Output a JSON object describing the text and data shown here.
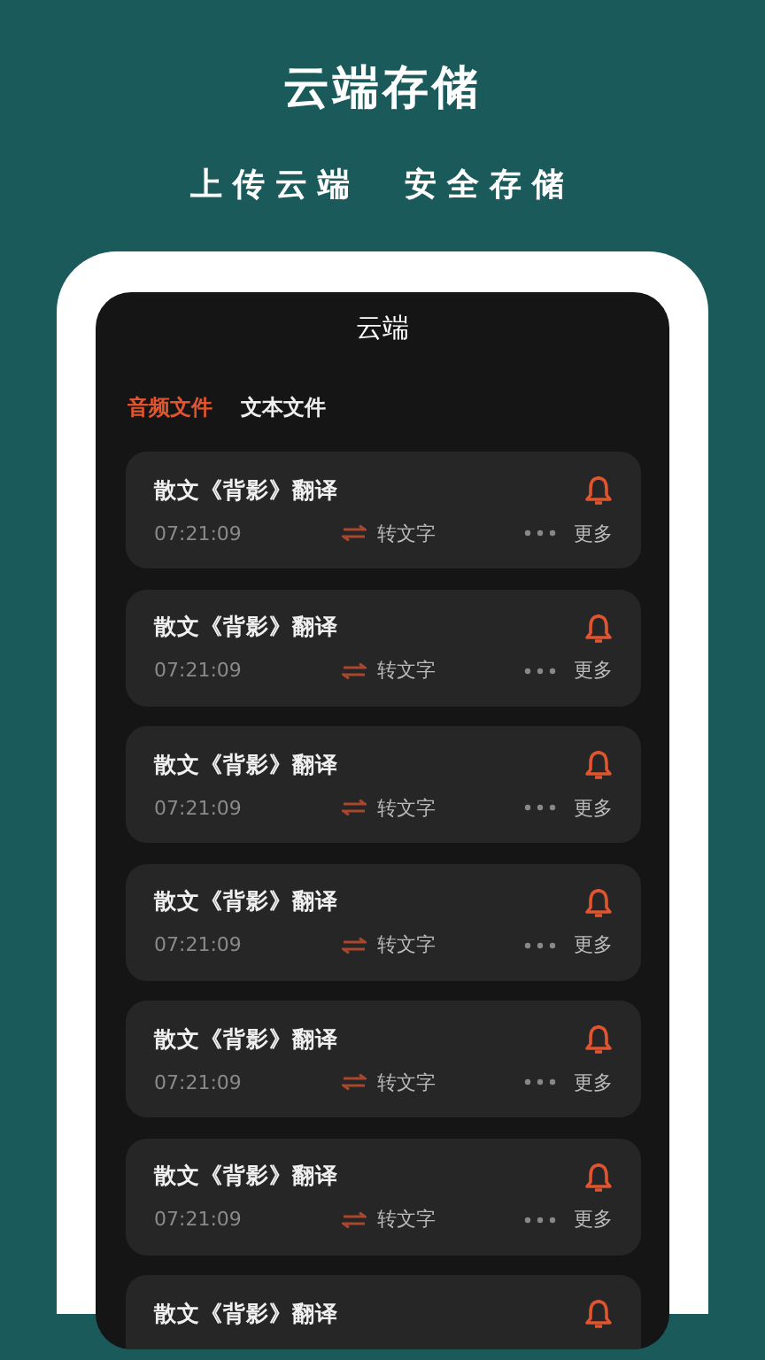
{
  "headline": "云端存储",
  "tagline": "上传云端  安全存储",
  "screen": {
    "title": "云端",
    "tabs": [
      {
        "label": "音频文件",
        "selected": true
      },
      {
        "label": "文本文件",
        "selected": false
      }
    ],
    "files": [
      {
        "title": "散文《背影》翻译",
        "time": "07:21:09",
        "convert": "转文字",
        "more": "更多"
      },
      {
        "title": "散文《背影》翻译",
        "time": "07:21:09",
        "convert": "转文字",
        "more": "更多"
      },
      {
        "title": "散文《背影》翻译",
        "time": "07:21:09",
        "convert": "转文字",
        "more": "更多"
      },
      {
        "title": "散文《背影》翻译",
        "time": "07:21:09",
        "convert": "转文字",
        "more": "更多"
      },
      {
        "title": "散文《背影》翻译",
        "time": "07:21:09",
        "convert": "转文字",
        "more": "更多"
      },
      {
        "title": "散文《背影》翻译",
        "time": "07:21:09",
        "convert": "转文字",
        "more": "更多"
      },
      {
        "title": "散文《背影》翻译"
      }
    ]
  }
}
